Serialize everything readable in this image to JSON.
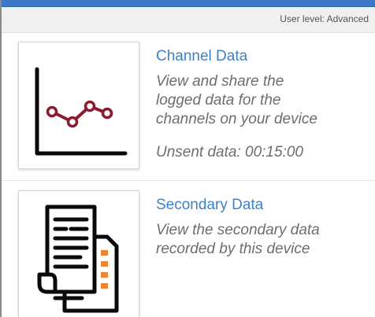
{
  "header": {
    "user_level": "User level: Advanced",
    "accent_color": "#3b78c8"
  },
  "cards": [
    {
      "title": "Channel Data",
      "description_lines": [
        "View and share the",
        "logged data for the",
        "channels on your device"
      ],
      "unsent": "Unsent data: 00:15:00",
      "icon": "line-chart-icon"
    },
    {
      "title": "Secondary Data",
      "description_lines": [
        "View the secondary data",
        "recorded by this device"
      ],
      "icon": "documents-icon"
    }
  ],
  "colors": {
    "title": "#3d82c4",
    "description": "#6d6d6d",
    "chart_series": "#8c1c2c",
    "doc_bullets": "#e8873a"
  }
}
